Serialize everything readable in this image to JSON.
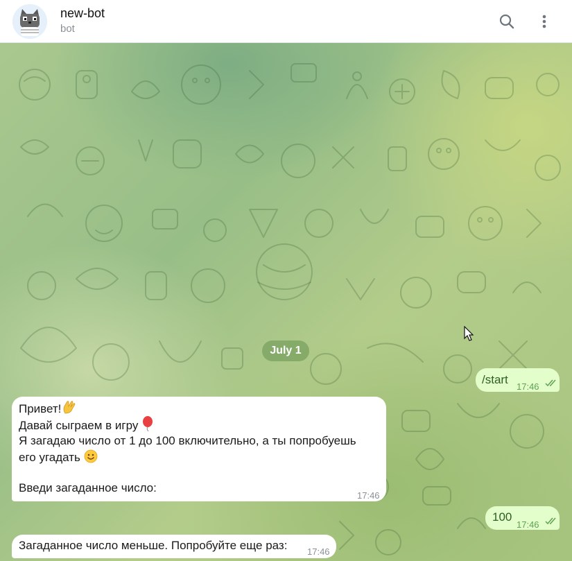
{
  "header": {
    "bot_name": "new-bot",
    "bot_subtitle": "bot",
    "avatar_icon": "cat-avatar-icon",
    "search_icon": "search-icon",
    "menu_icon": "more-vert-icon"
  },
  "chat": {
    "date_separator": "July 1",
    "messages": [
      {
        "direction": "out",
        "text": "/start",
        "time": "17:46",
        "status": "read"
      },
      {
        "direction": "in",
        "lines": [
          "Привет!",
          "Давай сыграем в игру ",
          "Я загадаю число от 1 до 100 включительно, а ты попробуешь",
          "его угадать ",
          "",
          "Введи загаданное число:"
        ],
        "emojis": [
          "waving-hand-icon",
          "balloon-icon",
          "smiling-face-icon"
        ],
        "time": "17:46"
      },
      {
        "direction": "out",
        "text": "100",
        "time": "17:46",
        "status": "read"
      },
      {
        "direction": "in",
        "text": "Загаданное число меньше. Попробуйте еще раз:",
        "time": "17:46"
      }
    ]
  },
  "colors": {
    "outgoing_bubble": "#e3fdcb",
    "incoming_bubble": "#ffffff",
    "date_pill": "#78a05f",
    "read_ticks": "#5ea252"
  }
}
